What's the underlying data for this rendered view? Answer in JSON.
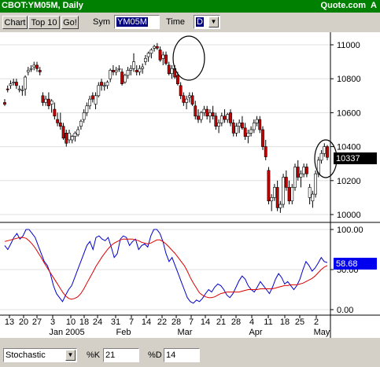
{
  "title_bar": {
    "title": "CBOT:YM05M, Daily",
    "brand": "Quote.com",
    "badge": "A"
  },
  "toolbar": {
    "chart_label": "Chart",
    "top10_label": "Top 10",
    "go_label": "Go!",
    "sym_label": "Sym",
    "sym_value": "YM05M",
    "time_label": "Time",
    "time_value": "D"
  },
  "price_panel": {
    "y_ticks": [
      "11000",
      "10800",
      "10600",
      "10400",
      "10200",
      "10000"
    ],
    "last_price": "10337",
    "colors": {
      "up": "#ffffff",
      "down": "#cc0000",
      "ring": "#000000",
      "current": "#000000"
    }
  },
  "stoch_panel": {
    "y_ticks": [
      "100.00",
      "50.00",
      "0.00"
    ],
    "last_value": "58.68",
    "colors": {
      "k_line": "#0000cc",
      "d_line": "#dd0000",
      "current": "#0000ee"
    }
  },
  "x_axis": {
    "days": [
      "13",
      "20",
      "27",
      "3",
      "10",
      "18",
      "24",
      "31",
      "7",
      "14",
      "22",
      "28",
      "7",
      "14",
      "21",
      "28",
      "4",
      "11",
      "18",
      "25",
      "2"
    ],
    "months": [
      "Jan 2005",
      "Feb",
      "Mar",
      "Apr",
      "May"
    ]
  },
  "chart_data": {
    "type": "candlestick",
    "price_range": [
      10000,
      11100
    ],
    "candles_ohlc": [
      [
        10660,
        10680,
        10640,
        10650
      ],
      [
        10740,
        10760,
        10720,
        10735
      ],
      [
        10760,
        10790,
        10740,
        10770
      ],
      [
        10780,
        10800,
        10760,
        10780
      ],
      [
        10780,
        10800,
        10740,
        10760
      ],
      [
        10740,
        10760,
        10720,
        10740
      ],
      [
        10730,
        10760,
        10700,
        10735
      ],
      [
        10740,
        10820,
        10700,
        10810
      ],
      [
        10840,
        10870,
        10820,
        10850
      ],
      [
        10860,
        10880,
        10840,
        10860
      ],
      [
        10870,
        10900,
        10850,
        10880
      ],
      [
        10880,
        10900,
        10840,
        10860
      ],
      [
        10850,
        10870,
        10820,
        10840
      ],
      [
        10700,
        10720,
        10640,
        10660
      ],
      [
        10660,
        10700,
        10640,
        10680
      ],
      [
        10680,
        10720,
        10620,
        10640
      ],
      [
        10650,
        10680,
        10600,
        10670
      ],
      [
        10620,
        10660,
        10560,
        10580
      ],
      [
        10560,
        10600,
        10520,
        10540
      ],
      [
        10540,
        10600,
        10500,
        10520
      ],
      [
        10520,
        10540,
        10440,
        10450
      ],
      [
        10480,
        10500,
        10400,
        10420
      ],
      [
        10440,
        10500,
        10420,
        10480
      ],
      [
        10440,
        10470,
        10420,
        10460
      ],
      [
        10460,
        10490,
        10430,
        10480
      ],
      [
        10470,
        10520,
        10460,
        10500
      ],
      [
        10520,
        10560,
        10500,
        10550
      ],
      [
        10560,
        10620,
        10540,
        10600
      ],
      [
        10600,
        10660,
        10580,
        10640
      ],
      [
        10640,
        10700,
        10620,
        10680
      ],
      [
        10700,
        10720,
        10660,
        10680
      ],
      [
        10650,
        10720,
        10620,
        10700
      ],
      [
        10700,
        10780,
        10690,
        10760
      ],
      [
        10780,
        10800,
        10730,
        10760
      ],
      [
        10760,
        10780,
        10730,
        10760
      ],
      [
        10760,
        10790,
        10740,
        10780
      ],
      [
        10800,
        10860,
        10780,
        10850
      ],
      [
        10850,
        10880,
        10820,
        10840
      ],
      [
        10840,
        10870,
        10820,
        10850
      ],
      [
        10860,
        10880,
        10840,
        10860
      ],
      [
        10840,
        10860,
        10760,
        10770
      ],
      [
        10780,
        10830,
        10770,
        10820
      ],
      [
        10820,
        10870,
        10800,
        10850
      ],
      [
        10850,
        10880,
        10820,
        10860
      ],
      [
        10860,
        10950,
        10840,
        10900
      ],
      [
        10850,
        10880,
        10820,
        10840
      ],
      [
        10840,
        10880,
        10820,
        10860
      ],
      [
        10860,
        10890,
        10830,
        10870
      ],
      [
        10900,
        10940,
        10880,
        10920
      ],
      [
        10930,
        10960,
        10900,
        10950
      ],
      [
        10950,
        10980,
        10920,
        10970
      ],
      [
        10980,
        11000,
        10960,
        10990
      ],
      [
        10990,
        11010,
        10970,
        10980
      ],
      [
        10970,
        10990,
        10900,
        10910
      ],
      [
        10920,
        10960,
        10880,
        10940
      ],
      [
        10940,
        10960,
        10880,
        10890
      ],
      [
        10880,
        10900,
        10820,
        10830
      ],
      [
        10830,
        10880,
        10800,
        10860
      ],
      [
        10860,
        10880,
        10800,
        10810
      ],
      [
        10820,
        10840,
        10760,
        10770
      ],
      [
        10760,
        10780,
        10680,
        10700
      ],
      [
        10700,
        10720,
        10640,
        10660
      ],
      [
        10660,
        10700,
        10620,
        10680
      ],
      [
        10690,
        10720,
        10660,
        10700
      ],
      [
        10700,
        10720,
        10640,
        10650
      ],
      [
        10640,
        10670,
        10560,
        10580
      ],
      [
        10580,
        10620,
        10540,
        10560
      ],
      [
        10560,
        10610,
        10540,
        10600
      ],
      [
        10600,
        10640,
        10580,
        10620
      ],
      [
        10620,
        10640,
        10560,
        10580
      ],
      [
        10580,
        10620,
        10540,
        10600
      ],
      [
        10600,
        10640,
        10560,
        10580
      ],
      [
        10580,
        10600,
        10500,
        10520
      ],
      [
        10520,
        10560,
        10480,
        10540
      ],
      [
        10540,
        10600,
        10520,
        10580
      ],
      [
        10580,
        10620,
        10540,
        10560
      ],
      [
        10560,
        10600,
        10540,
        10590
      ],
      [
        10600,
        10620,
        10520,
        10540
      ],
      [
        10540,
        10560,
        10460,
        10480
      ],
      [
        10480,
        10540,
        10460,
        10520
      ],
      [
        10520,
        10560,
        10480,
        10540
      ],
      [
        10540,
        10580,
        10500,
        10510
      ],
      [
        10510,
        10540,
        10440,
        10460
      ],
      [
        10460,
        10500,
        10420,
        10480
      ],
      [
        10480,
        10520,
        10460,
        10500
      ],
      [
        10500,
        10560,
        10480,
        10540
      ],
      [
        10540,
        10580,
        10520,
        10560
      ],
      [
        10560,
        10580,
        10480,
        10500
      ],
      [
        10500,
        10520,
        10380,
        10400
      ],
      [
        10400,
        10440,
        10320,
        10340
      ],
      [
        10260,
        10280,
        10060,
        10080
      ],
      [
        10080,
        10120,
        10020,
        10100
      ],
      [
        10100,
        10180,
        10080,
        10160
      ],
      [
        10160,
        10200,
        10020,
        10040
      ],
      [
        10040,
        10080,
        10010,
        10060
      ],
      [
        10060,
        10240,
        10040,
        10220
      ],
      [
        10220,
        10260,
        10140,
        10160
      ],
      [
        10160,
        10200,
        10060,
        10080
      ],
      [
        10080,
        10180,
        10060,
        10160
      ],
      [
        10160,
        10300,
        10140,
        10280
      ],
      [
        10280,
        10320,
        10200,
        10220
      ],
      [
        10220,
        10260,
        10160,
        10240
      ],
      [
        10240,
        10300,
        10220,
        10280
      ],
      [
        10280,
        10300,
        10220,
        10240
      ],
      [
        10100,
        10180,
        10060,
        10160
      ],
      [
        10080,
        10140,
        10040,
        10120
      ],
      [
        10120,
        10260,
        10100,
        10240
      ],
      [
        10240,
        10340,
        10220,
        10320
      ],
      [
        10320,
        10380,
        10300,
        10360
      ],
      [
        10360,
        10420,
        10340,
        10400
      ],
      [
        10400,
        10410,
        10320,
        10337
      ]
    ],
    "stochastic": {
      "k_range": [
        0,
        100
      ],
      "k": [
        80,
        75,
        82,
        90,
        95,
        88,
        92,
        100,
        100,
        95,
        90,
        80,
        70,
        60,
        55,
        45,
        30,
        20,
        15,
        10,
        18,
        25,
        30,
        40,
        50,
        60,
        70,
        80,
        85,
        75,
        90,
        92,
        88,
        86,
        90,
        78,
        65,
        70,
        88,
        92,
        90,
        80,
        85,
        88,
        75,
        80,
        82,
        78,
        92,
        100,
        100,
        95,
        85,
        70,
        60,
        65,
        55,
        45,
        35,
        25,
        15,
        10,
        8,
        12,
        10,
        14,
        20,
        25,
        22,
        28,
        32,
        30,
        25,
        18,
        15,
        20,
        28,
        36,
        42,
        38,
        30,
        25,
        22,
        28,
        35,
        30,
        25,
        20,
        28,
        38,
        45,
        40,
        32,
        35,
        30,
        25,
        30,
        38,
        50,
        60,
        55,
        48,
        52,
        58,
        65,
        60,
        58.68
      ],
      "d": [
        85,
        86,
        87,
        88,
        89,
        90,
        90,
        89,
        86,
        82,
        77,
        71,
        65,
        58,
        52,
        46,
        40,
        34,
        28,
        22,
        17,
        14,
        13,
        14,
        16,
        20,
        26,
        33,
        40,
        47,
        54,
        60,
        66,
        71,
        76,
        80,
        83,
        85,
        87,
        88,
        88,
        88,
        88,
        87,
        86,
        84,
        83,
        82,
        83,
        85,
        87,
        87,
        85,
        82,
        78,
        74,
        70,
        65,
        60,
        55,
        48,
        40,
        33,
        27,
        21,
        18,
        16,
        15,
        15,
        16,
        18,
        20,
        21,
        22,
        22,
        22,
        22,
        22,
        23,
        24,
        25,
        25,
        25,
        25,
        26,
        26,
        26,
        26,
        26,
        27,
        28,
        29,
        30,
        30,
        31,
        31,
        31,
        32,
        33,
        35,
        37,
        39,
        42,
        46,
        50,
        53,
        55
      ]
    }
  }
}
